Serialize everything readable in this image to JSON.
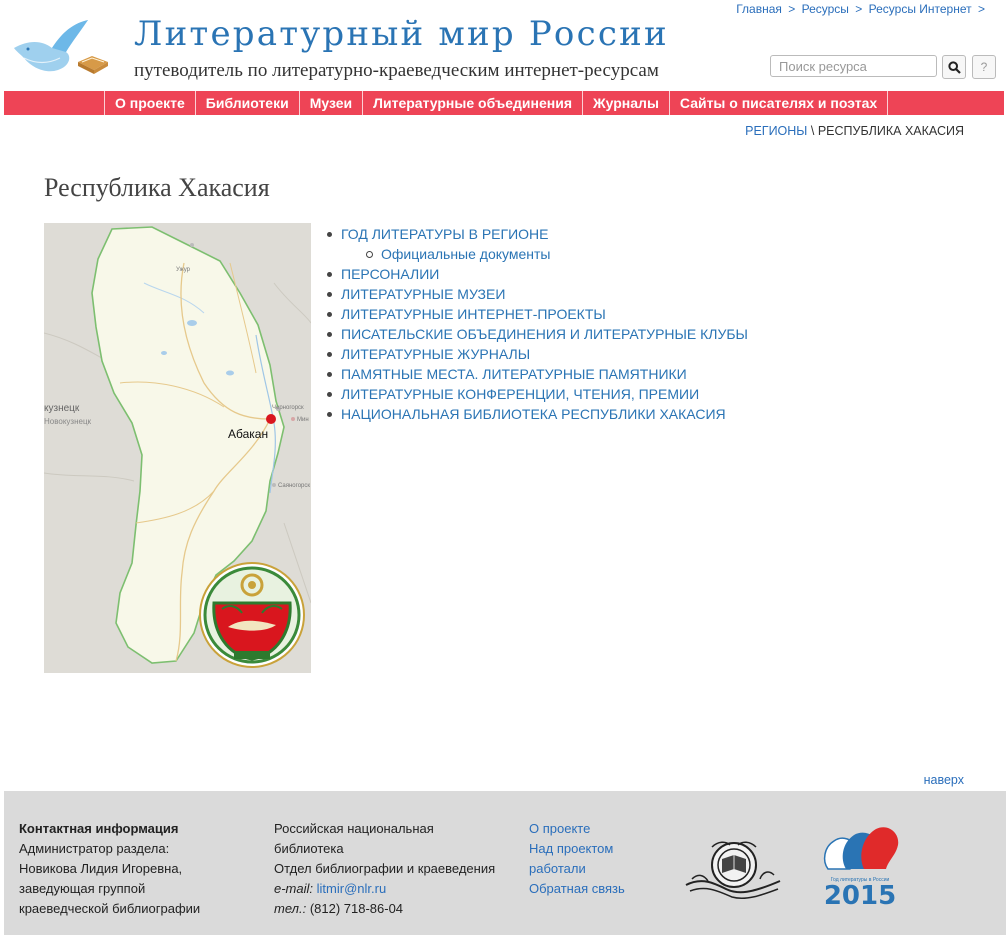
{
  "header": {
    "breadcrumbs": [
      "Главная",
      "Ресурсы",
      "Ресурсы Интернет"
    ],
    "breadcrumb_separator": ">",
    "title": "Литературный мир России",
    "subtitle": "путеводитель по литературно-краеведческим интернет-ресурсам",
    "search": {
      "placeholder": "Поиск ресурса",
      "value": ""
    },
    "help_label": "?"
  },
  "nav": [
    "О проекте",
    "Библиотеки",
    "Музеи",
    "Литературные объединения",
    "Журналы",
    "Сайты о писателях и поэтах"
  ],
  "region_crumb": {
    "parent": "РЕГИОНЫ",
    "separator": "\\",
    "current": "РЕСПУБЛИКА ХАКАСИЯ"
  },
  "page_title": "Республика Хакасия",
  "map": {
    "city_label": "Абакан",
    "left_labels": [
      "кузнецк",
      "Новокузнецк"
    ],
    "small_labels": [
      "Черногорск",
      "Мин",
      "Саяногорск",
      "Ужур"
    ],
    "city_marker_color": "#d9161e"
  },
  "topics": [
    {
      "label": "ГОД ЛИТЕРАТУРЫ В РЕГИОНЕ",
      "level": 1
    },
    {
      "label": "Официальные документы",
      "level": 2
    },
    {
      "label": "ПЕРСОНАЛИИ",
      "level": 1
    },
    {
      "label": "ЛИТЕРАТУРНЫЕ МУЗЕИ",
      "level": 1
    },
    {
      "label": "ЛИТЕРАТУРНЫЕ ИНТЕРНЕТ-ПРОЕКТЫ",
      "level": 1
    },
    {
      "label": "ПИСАТЕЛЬСКИЕ ОБЪЕДИНЕНИЯ И ЛИТЕРАТУРНЫЕ КЛУБЫ",
      "level": 1
    },
    {
      "label": "ЛИТЕРАТУРНЫЕ ЖУРНАЛЫ",
      "level": 1
    },
    {
      "label": "ПАМЯТНЫЕ МЕСТА. ЛИТЕРАТУРНЫЕ ПАМЯТНИКИ",
      "level": 1
    },
    {
      "label": "ЛИТЕРАТУРНЫЕ КОНФЕРЕНЦИИ, ЧТЕНИЯ, ПРЕМИИ",
      "level": 1
    },
    {
      "label": "НАЦИОНАЛЬНАЯ БИБЛИОТЕКА РЕСПУБЛИКИ ХАКАСИЯ",
      "level": 1
    }
  ],
  "to_top": "наверх",
  "footer": {
    "contact": {
      "heading": "Контактная информация",
      "lines": [
        "Администратор раздела:",
        "Новикова Лидия Игоревна,",
        "заведующая группой",
        "краеведческой библиографии"
      ]
    },
    "org": {
      "lines": [
        "Российская национальная",
        "библиотека",
        "Отдел библиографии и краеведения"
      ],
      "email_label": "e-mail:",
      "email": "litmir@nlr.ru",
      "phone_label": "тел.:",
      "phone": "(812) 718-86-04"
    },
    "links": [
      "О проекте",
      "Над проектом работали",
      "Обратная связь"
    ],
    "year_logo": {
      "caption": "Год литературы в России",
      "year": "2015"
    }
  },
  "colors": {
    "nav_bg": "#ee4456",
    "title_blue": "#2a74b4",
    "link_blue": "#2a6ebb",
    "footer_bg": "#dadada"
  }
}
